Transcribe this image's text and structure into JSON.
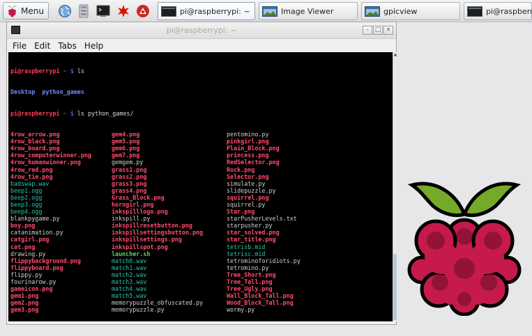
{
  "taskbar": {
    "menu_label": "Menu",
    "launchers": [
      "web-browser-icon",
      "file-manager-icon",
      "terminal-icon",
      "wolfram-icon",
      "mathematica-icon"
    ],
    "tasks": [
      {
        "label": "pi@raspberrypi: ~",
        "icon": "terminal-icon",
        "active": true
      },
      {
        "label": "Image Viewer",
        "icon": "image-viewer-icon",
        "active": false
      },
      {
        "label": "gpicview",
        "icon": "image-viewer-icon",
        "active": false
      },
      {
        "label": "pi@raspberryp",
        "icon": "terminal-icon",
        "active": false
      }
    ]
  },
  "window": {
    "title": "pi@raspberrypi: ~",
    "menu": [
      "File",
      "Edit",
      "Tabs",
      "Help"
    ]
  },
  "terminal": {
    "prompt": "pi@raspberrypi",
    "path_sep": " ~ $ ",
    "cmd1": "ls",
    "ls_home": [
      "Desktop",
      "python_games"
    ],
    "cmd2": "ls python_games/",
    "listing": [
      [
        {
          "n": "4row_arrow.png",
          "t": "png"
        },
        {
          "n": "gem4.png",
          "t": "png"
        },
        {
          "n": "pentomino.py",
          "t": "py"
        }
      ],
      [
        {
          "n": "4row_black.png",
          "t": "png"
        },
        {
          "n": "gem5.png",
          "t": "png"
        },
        {
          "n": "pinkgirl.png",
          "t": "png"
        }
      ],
      [
        {
          "n": "4row_board.png",
          "t": "png"
        },
        {
          "n": "gem6.png",
          "t": "png"
        },
        {
          "n": "Plain_Block.png",
          "t": "png"
        }
      ],
      [
        {
          "n": "4row_computerwinner.png",
          "t": "png"
        },
        {
          "n": "gem7.png",
          "t": "png"
        },
        {
          "n": "princess.png",
          "t": "png"
        }
      ],
      [
        {
          "n": "4row_humanwinner.png",
          "t": "png"
        },
        {
          "n": "gemgem.py",
          "t": "py"
        },
        {
          "n": "RedSelector.png",
          "t": "png"
        }
      ],
      [
        {
          "n": "4row_red.png",
          "t": "png"
        },
        {
          "n": "grass1.png",
          "t": "png"
        },
        {
          "n": "Rock.png",
          "t": "png"
        }
      ],
      [
        {
          "n": "4row_tie.png",
          "t": "png"
        },
        {
          "n": "grass2.png",
          "t": "png"
        },
        {
          "n": "Selector.png",
          "t": "png"
        }
      ],
      [
        {
          "n": "badswap.wav",
          "t": "wav"
        },
        {
          "n": "grass3.png",
          "t": "png"
        },
        {
          "n": "simulate.py",
          "t": "py"
        }
      ],
      [
        {
          "n": "beep1.ogg",
          "t": "ogg"
        },
        {
          "n": "grass4.png",
          "t": "png"
        },
        {
          "n": "slidepuzzle.py",
          "t": "py"
        }
      ],
      [
        {
          "n": "beep2.ogg",
          "t": "ogg"
        },
        {
          "n": "Grass_Block.png",
          "t": "png"
        },
        {
          "n": "squirrel.png",
          "t": "png"
        }
      ],
      [
        {
          "n": "beep3.ogg",
          "t": "ogg"
        },
        {
          "n": "horngirl.png",
          "t": "png"
        },
        {
          "n": "squirrel.py",
          "t": "py"
        }
      ],
      [
        {
          "n": "beep4.ogg",
          "t": "ogg"
        },
        {
          "n": "inkspilllogo.png",
          "t": "png"
        },
        {
          "n": "Star.png",
          "t": "png"
        }
      ],
      [
        {
          "n": "blankpygame.py",
          "t": "py"
        },
        {
          "n": "inkspill.py",
          "t": "py"
        },
        {
          "n": "starPusherLevels.txt",
          "t": "txt"
        }
      ],
      [
        {
          "n": "boy.png",
          "t": "png"
        },
        {
          "n": "inkspillresetbutton.png",
          "t": "png"
        },
        {
          "n": "starpusher.py",
          "t": "py"
        }
      ],
      [
        {
          "n": "catanimation.py",
          "t": "py"
        },
        {
          "n": "inkspillsettingsbutton.png",
          "t": "png"
        },
        {
          "n": "star_solved.png",
          "t": "png"
        }
      ],
      [
        {
          "n": "catgirl.png",
          "t": "png"
        },
        {
          "n": "inkspillsettings.png",
          "t": "png"
        },
        {
          "n": "star_title.png",
          "t": "png"
        }
      ],
      [
        {
          "n": "cat.png",
          "t": "png"
        },
        {
          "n": "inkspillspot.png",
          "t": "png"
        },
        {
          "n": "tetrisb.mid",
          "t": "mid"
        }
      ],
      [
        {
          "n": "drawing.py",
          "t": "py"
        },
        {
          "n": "launcher.sh",
          "t": "sh"
        },
        {
          "n": "tetrisc.mid",
          "t": "mid"
        }
      ],
      [
        {
          "n": "flippybackground.png",
          "t": "png"
        },
        {
          "n": "match0.wav",
          "t": "wav"
        },
        {
          "n": "tetrominoforidiots.py",
          "t": "py"
        }
      ],
      [
        {
          "n": "flippyboard.png",
          "t": "png"
        },
        {
          "n": "match1.wav",
          "t": "wav"
        },
        {
          "n": "tetromino.py",
          "t": "py"
        }
      ],
      [
        {
          "n": "flippy.py",
          "t": "py"
        },
        {
          "n": "match2.wav",
          "t": "wav"
        },
        {
          "n": "Tree_Short.png",
          "t": "png"
        }
      ],
      [
        {
          "n": "fourinarow.py",
          "t": "py"
        },
        {
          "n": "match3.wav",
          "t": "wav"
        },
        {
          "n": "Tree_Tall.png",
          "t": "png"
        }
      ],
      [
        {
          "n": "gameicon.png",
          "t": "png"
        },
        {
          "n": "match4.wav",
          "t": "wav"
        },
        {
          "n": "Tree_Ugly.png",
          "t": "png"
        }
      ],
      [
        {
          "n": "gem1.png",
          "t": "png"
        },
        {
          "n": "match5.wav",
          "t": "wav"
        },
        {
          "n": "Wall_Block_Tall.png",
          "t": "png"
        }
      ],
      [
        {
          "n": "gem2.png",
          "t": "png"
        },
        {
          "n": "memorypuzzle_obfuscated.py",
          "t": "py"
        },
        {
          "n": "Wood_Block_Tall.png",
          "t": "png"
        }
      ],
      [
        {
          "n": "gem3.png",
          "t": "png"
        },
        {
          "n": "memorypuzzle.py",
          "t": "py"
        },
        {
          "n": "wormy.py",
          "t": "py"
        }
      ]
    ]
  },
  "desktop": {
    "logo": "raspberry-pi-logo"
  },
  "colors": {
    "prompt": "#ff3d52",
    "directory": "#6a8bff",
    "png": "#ff4d6e",
    "audio": "#2fc4a9",
    "script": "#5fd35f",
    "logo_red": "#c51a4a",
    "logo_green": "#75a928"
  }
}
